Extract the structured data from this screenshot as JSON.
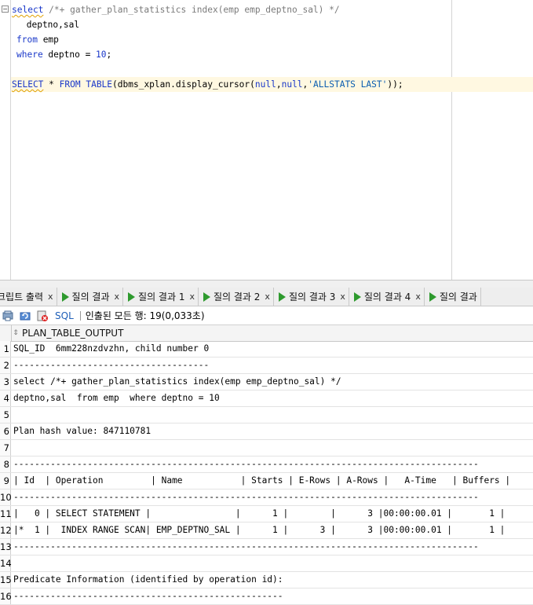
{
  "editor": {
    "lines": [
      [
        {
          "t": "select",
          "c": "kw squig"
        },
        {
          "t": " /*+ gather_plan_statistics index(emp emp_deptno_sal) */",
          "c": "cm"
        }
      ],
      [
        {
          "t": " deptno,sal",
          "c": ""
        }
      ],
      [
        {
          "t": "from",
          "c": "kw"
        },
        {
          "t": " emp",
          "c": ""
        }
      ],
      [
        {
          "t": "where",
          "c": "kw"
        },
        {
          "t": " deptno = ",
          "c": ""
        },
        {
          "t": "10",
          "c": "nm"
        },
        {
          "t": ";",
          "c": ""
        }
      ],
      [],
      [
        {
          "t": "SELECT",
          "c": "kw squig"
        },
        {
          "t": " * ",
          "c": ""
        },
        {
          "t": "FROM",
          "c": "kw"
        },
        {
          "t": " ",
          "c": ""
        },
        {
          "t": "TABLE",
          "c": "kw"
        },
        {
          "t": "(dbms_xplan.display_cursor(",
          "c": ""
        },
        {
          "t": "null",
          "c": "kw"
        },
        {
          "t": ",",
          "c": ""
        },
        {
          "t": "null",
          "c": "kw"
        },
        {
          "t": ",",
          "c": ""
        },
        {
          "t": "'ALLSTATS LAST'",
          "c": "st"
        },
        {
          "t": "));",
          "c": ""
        }
      ]
    ]
  },
  "tabs": [
    {
      "label": "크립트 출력",
      "play": false
    },
    {
      "label": "질의 결과",
      "play": true
    },
    {
      "label": "질의 결과 1",
      "play": true
    },
    {
      "label": "질의 결과 2",
      "play": true
    },
    {
      "label": "질의 결과 3",
      "play": true
    },
    {
      "label": "질의 결과 4",
      "play": true
    },
    {
      "label": "질의 결과",
      "play": true
    }
  ],
  "tab_close": "x",
  "toolbar": {
    "sql_label": "SQL",
    "status": "인출된 모든 행: 19(0,033초)"
  },
  "grid": {
    "column": "PLAN_TABLE_OUTPUT",
    "rows": [
      {
        "n": "1",
        "text": "SQL_ID  6mm228nzdvzhn, child number 0"
      },
      {
        "n": "2",
        "text": "-------------------------------------"
      },
      {
        "n": "3",
        "text": "select /*+ gather_plan_statistics index(emp emp_deptno_sal) */"
      },
      {
        "n": "4",
        "text": "deptno,sal  from emp  where deptno = 10"
      },
      {
        "n": "5",
        "text": ""
      },
      {
        "n": "6",
        "text": "Plan hash value: 847110781"
      },
      {
        "n": "7",
        "text": ""
      },
      {
        "n": "8",
        "text": "----------------------------------------------------------------------------------------"
      },
      {
        "n": "9",
        "text": "| Id  | Operation         | Name           | Starts | E-Rows | A-Rows |   A-Time   | Buffers |"
      },
      {
        "n": "10",
        "text": "----------------------------------------------------------------------------------------"
      },
      {
        "n": "11",
        "text": "|   0 | SELECT STATEMENT |                |      1 |        |      3 |00:00:00.01 |       1 |"
      },
      {
        "n": "12",
        "text": "|*  1 |  INDEX RANGE SCAN| EMP_DEPTNO_SAL |      1 |      3 |      3 |00:00:00.01 |       1 |"
      },
      {
        "n": "13",
        "text": "----------------------------------------------------------------------------------------"
      },
      {
        "n": "14",
        "text": ""
      },
      {
        "n": "15",
        "text": "Predicate Information (identified by operation id):"
      },
      {
        "n": "16",
        "text": "---------------------------------------------------"
      }
    ]
  },
  "colors": {
    "keyword": "#1a38c9",
    "comment": "#7a7a7a",
    "string": "#0a5db0",
    "current_line": "#fff8e1",
    "run_icon": "#2e9a2e",
    "sql_link": "#1f5fb8"
  }
}
